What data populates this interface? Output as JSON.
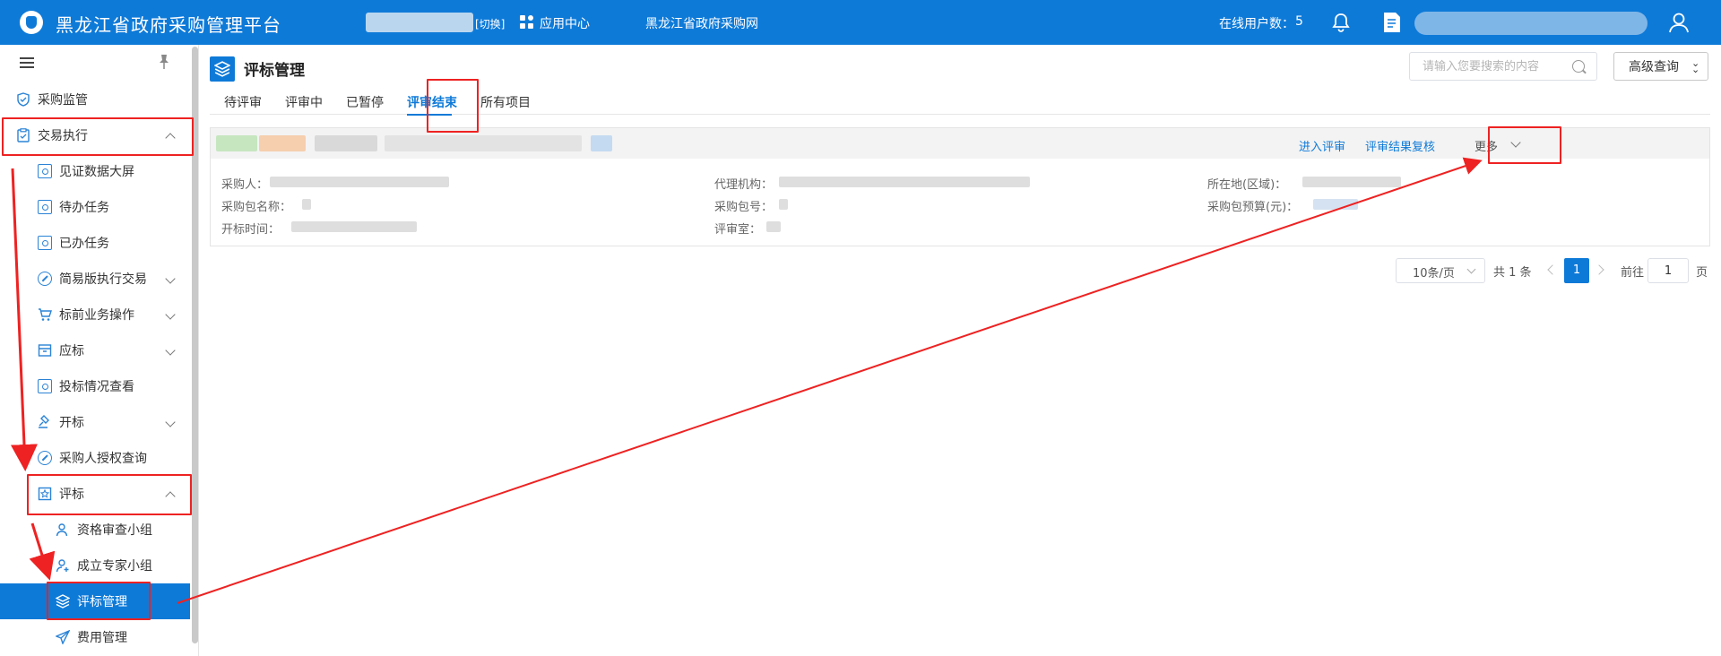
{
  "app": {
    "title": "黑龙江省政府采购管理平台",
    "switch_label": "[切换]",
    "apps_label": "应用中心",
    "site_link": "黑龙江省政府采购网",
    "online_label": "在线用户数：",
    "online_count": "5"
  },
  "sidebar": {
    "items": [
      {
        "label": "采购监管",
        "icon": "shield-check-icon"
      },
      {
        "label": "交易执行",
        "icon": "clipboard-icon",
        "expanded": true
      },
      {
        "label": "见证数据大屏",
        "icon": "monitor-icon"
      },
      {
        "label": "待办任务",
        "icon": "task-icon"
      },
      {
        "label": "已办任务",
        "icon": "task-done-icon"
      },
      {
        "label": "简易版执行交易",
        "icon": "circle-slash-icon"
      },
      {
        "label": "标前业务操作",
        "icon": "cart-icon"
      },
      {
        "label": "应标",
        "icon": "box-icon"
      },
      {
        "label": "投标情况查看",
        "icon": "search-doc-icon"
      },
      {
        "label": "开标",
        "icon": "gavel-icon"
      },
      {
        "label": "采购人授权查询",
        "icon": "auth-icon"
      },
      {
        "label": "评标",
        "icon": "star-doc-icon",
        "expanded": true
      },
      {
        "label": "资格审查小组",
        "icon": "user-group-icon"
      },
      {
        "label": "成立专家小组",
        "icon": "user-add-icon"
      },
      {
        "label": "评标管理",
        "icon": "layers-icon",
        "active": true
      },
      {
        "label": "费用管理",
        "icon": "send-icon"
      }
    ]
  },
  "main": {
    "title": "评标管理",
    "search_placeholder": "请输入您要搜索的内容",
    "advanced_label": "高级查询",
    "tabs": [
      {
        "label": "待评审"
      },
      {
        "label": "评审中"
      },
      {
        "label": "已暂停"
      },
      {
        "label": "评审结束",
        "active": true
      },
      {
        "label": "所有项目"
      }
    ],
    "card": {
      "actions": {
        "enter": "进入评审",
        "recheck": "评审结果复核",
        "more": "更多"
      },
      "fields": {
        "purchaser": "采购人：",
        "agency": "代理机构：",
        "region": "所在地(区域)：",
        "package_name": "采购包名称：",
        "package_no": "采购包号：",
        "budget": "采购包预算(元)：",
        "open_time": "开标时间：",
        "room": "评审室："
      }
    },
    "pagination": {
      "page_size": "10条/页",
      "total": "共 1 条",
      "current": "1",
      "goto_label": "前往",
      "goto_value": "1",
      "page_unit": "页"
    }
  },
  "colors": {
    "brand": "#0e7ad8",
    "annotation": "#ee2222"
  }
}
